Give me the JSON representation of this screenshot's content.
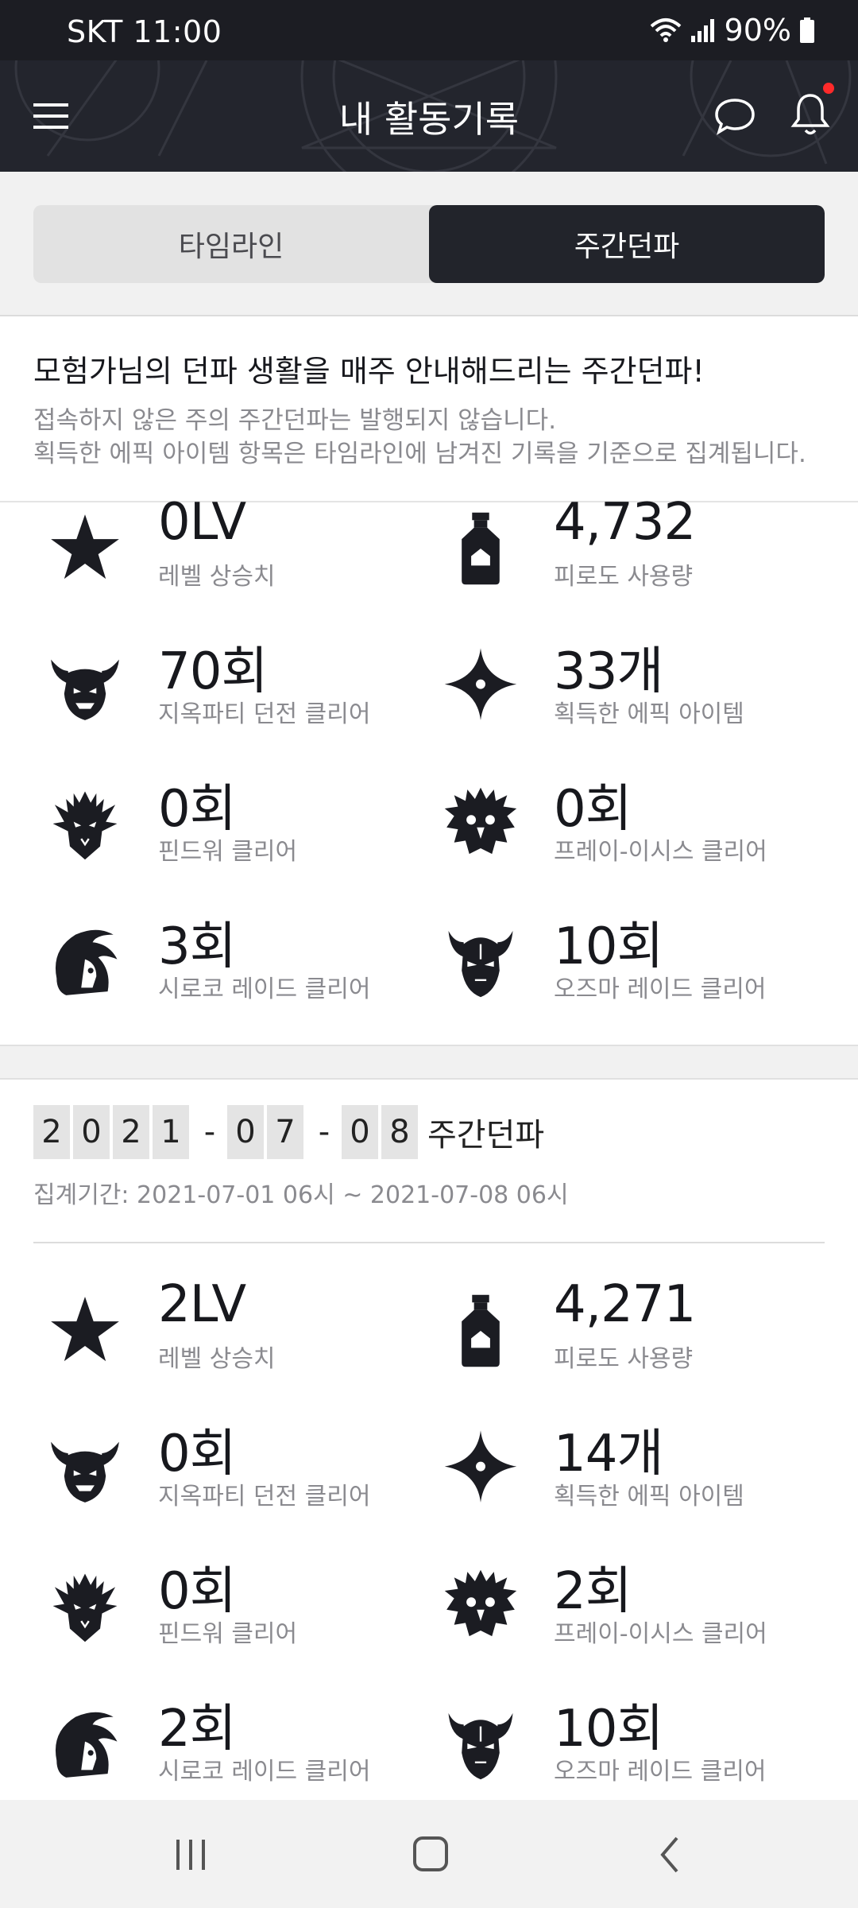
{
  "status_bar": {
    "carrier_time": "SKT 11:00",
    "battery": "90%"
  },
  "header": {
    "title": "내 활동기록"
  },
  "tabs": [
    {
      "label": "타임라인",
      "active": false
    },
    {
      "label": "주간던파",
      "active": true
    }
  ],
  "intro": {
    "heading": "모험가님의 던파 생활을 매주 안내해드리는 주간던파!",
    "line1": "접속하지 않은 주의 주간던파는 발행되지 않습니다.",
    "line2": "획득한 에픽 아이템 항목은 타임라인에 남겨진 기록을 기준으로 집계됩니다."
  },
  "week1": {
    "stats": [
      {
        "icon": "star-icon",
        "value": "0LV",
        "label": "레벨 상승치"
      },
      {
        "icon": "fatigue-potion-icon",
        "value": "4,732",
        "label": "피로도 사용량"
      },
      {
        "icon": "hell-party-demon-icon",
        "value": "70회",
        "label": "지옥파티 던전 클리어"
      },
      {
        "icon": "epic-sparkle-icon",
        "value": "33개",
        "label": "획득한 에픽 아이템"
      },
      {
        "icon": "findeuwo-dragon-icon",
        "value": "0회",
        "label": "핀드워 클리어"
      },
      {
        "icon": "prey-isys-bird-icon",
        "value": "0회",
        "label": "프레이-이시스 클리어"
      },
      {
        "icon": "siroco-face-icon",
        "value": "3회",
        "label": "시로코 레이드 클리어"
      },
      {
        "icon": "ozma-demon-icon",
        "value": "10회",
        "label": "오즈마 레이드 클리어"
      }
    ]
  },
  "week2": {
    "date_digits": [
      "2",
      "0",
      "2",
      "1",
      "-",
      "0",
      "7",
      "-",
      "0",
      "8"
    ],
    "suffix": "주간던파",
    "period": "집계기간: 2021-07-01 06시 ~ 2021-07-08 06시",
    "stats": [
      {
        "icon": "star-icon",
        "value": "2LV",
        "label": "레벨 상승치"
      },
      {
        "icon": "fatigue-potion-icon",
        "value": "4,271",
        "label": "피로도 사용량"
      },
      {
        "icon": "hell-party-demon-icon",
        "value": "0회",
        "label": "지옥파티 던전 클리어"
      },
      {
        "icon": "epic-sparkle-icon",
        "value": "14개",
        "label": "획득한 에픽 아이템"
      },
      {
        "icon": "findeuwo-dragon-icon",
        "value": "0회",
        "label": "핀드워 클리어"
      },
      {
        "icon": "prey-isys-bird-icon",
        "value": "2회",
        "label": "프레이-이시스 클리어"
      },
      {
        "icon": "siroco-face-icon",
        "value": "2회",
        "label": "시로코 레이드 클리어"
      },
      {
        "icon": "ozma-demon-icon",
        "value": "10회",
        "label": "오즈마 레이드 클리어"
      }
    ]
  },
  "colors": {
    "dark": "#22242b",
    "accent_dot": "#ff2a2a",
    "muted_text": "#8a8a8f"
  }
}
